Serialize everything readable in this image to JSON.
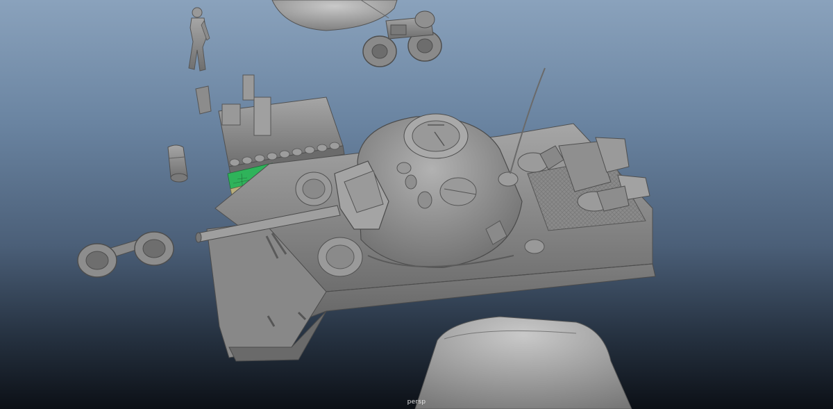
{
  "viewport": {
    "camera_label": "persp"
  },
  "colors": {
    "background_top": "#8aa2bc",
    "background_bottom": "#0c1016",
    "model_shade": "#8f8f8f",
    "selected_faces_green": "#2fb35a",
    "selected_faces_tan": "#b9ae7c"
  },
  "scene_objects": [
    "tank-hull",
    "tank-turret",
    "main-gun",
    "antenna",
    "soldier-figure",
    "motorcycle",
    "road-wheel-pair",
    "track-guard",
    "track-cover",
    "dome-part",
    "fuel-can",
    "engine-deck"
  ]
}
